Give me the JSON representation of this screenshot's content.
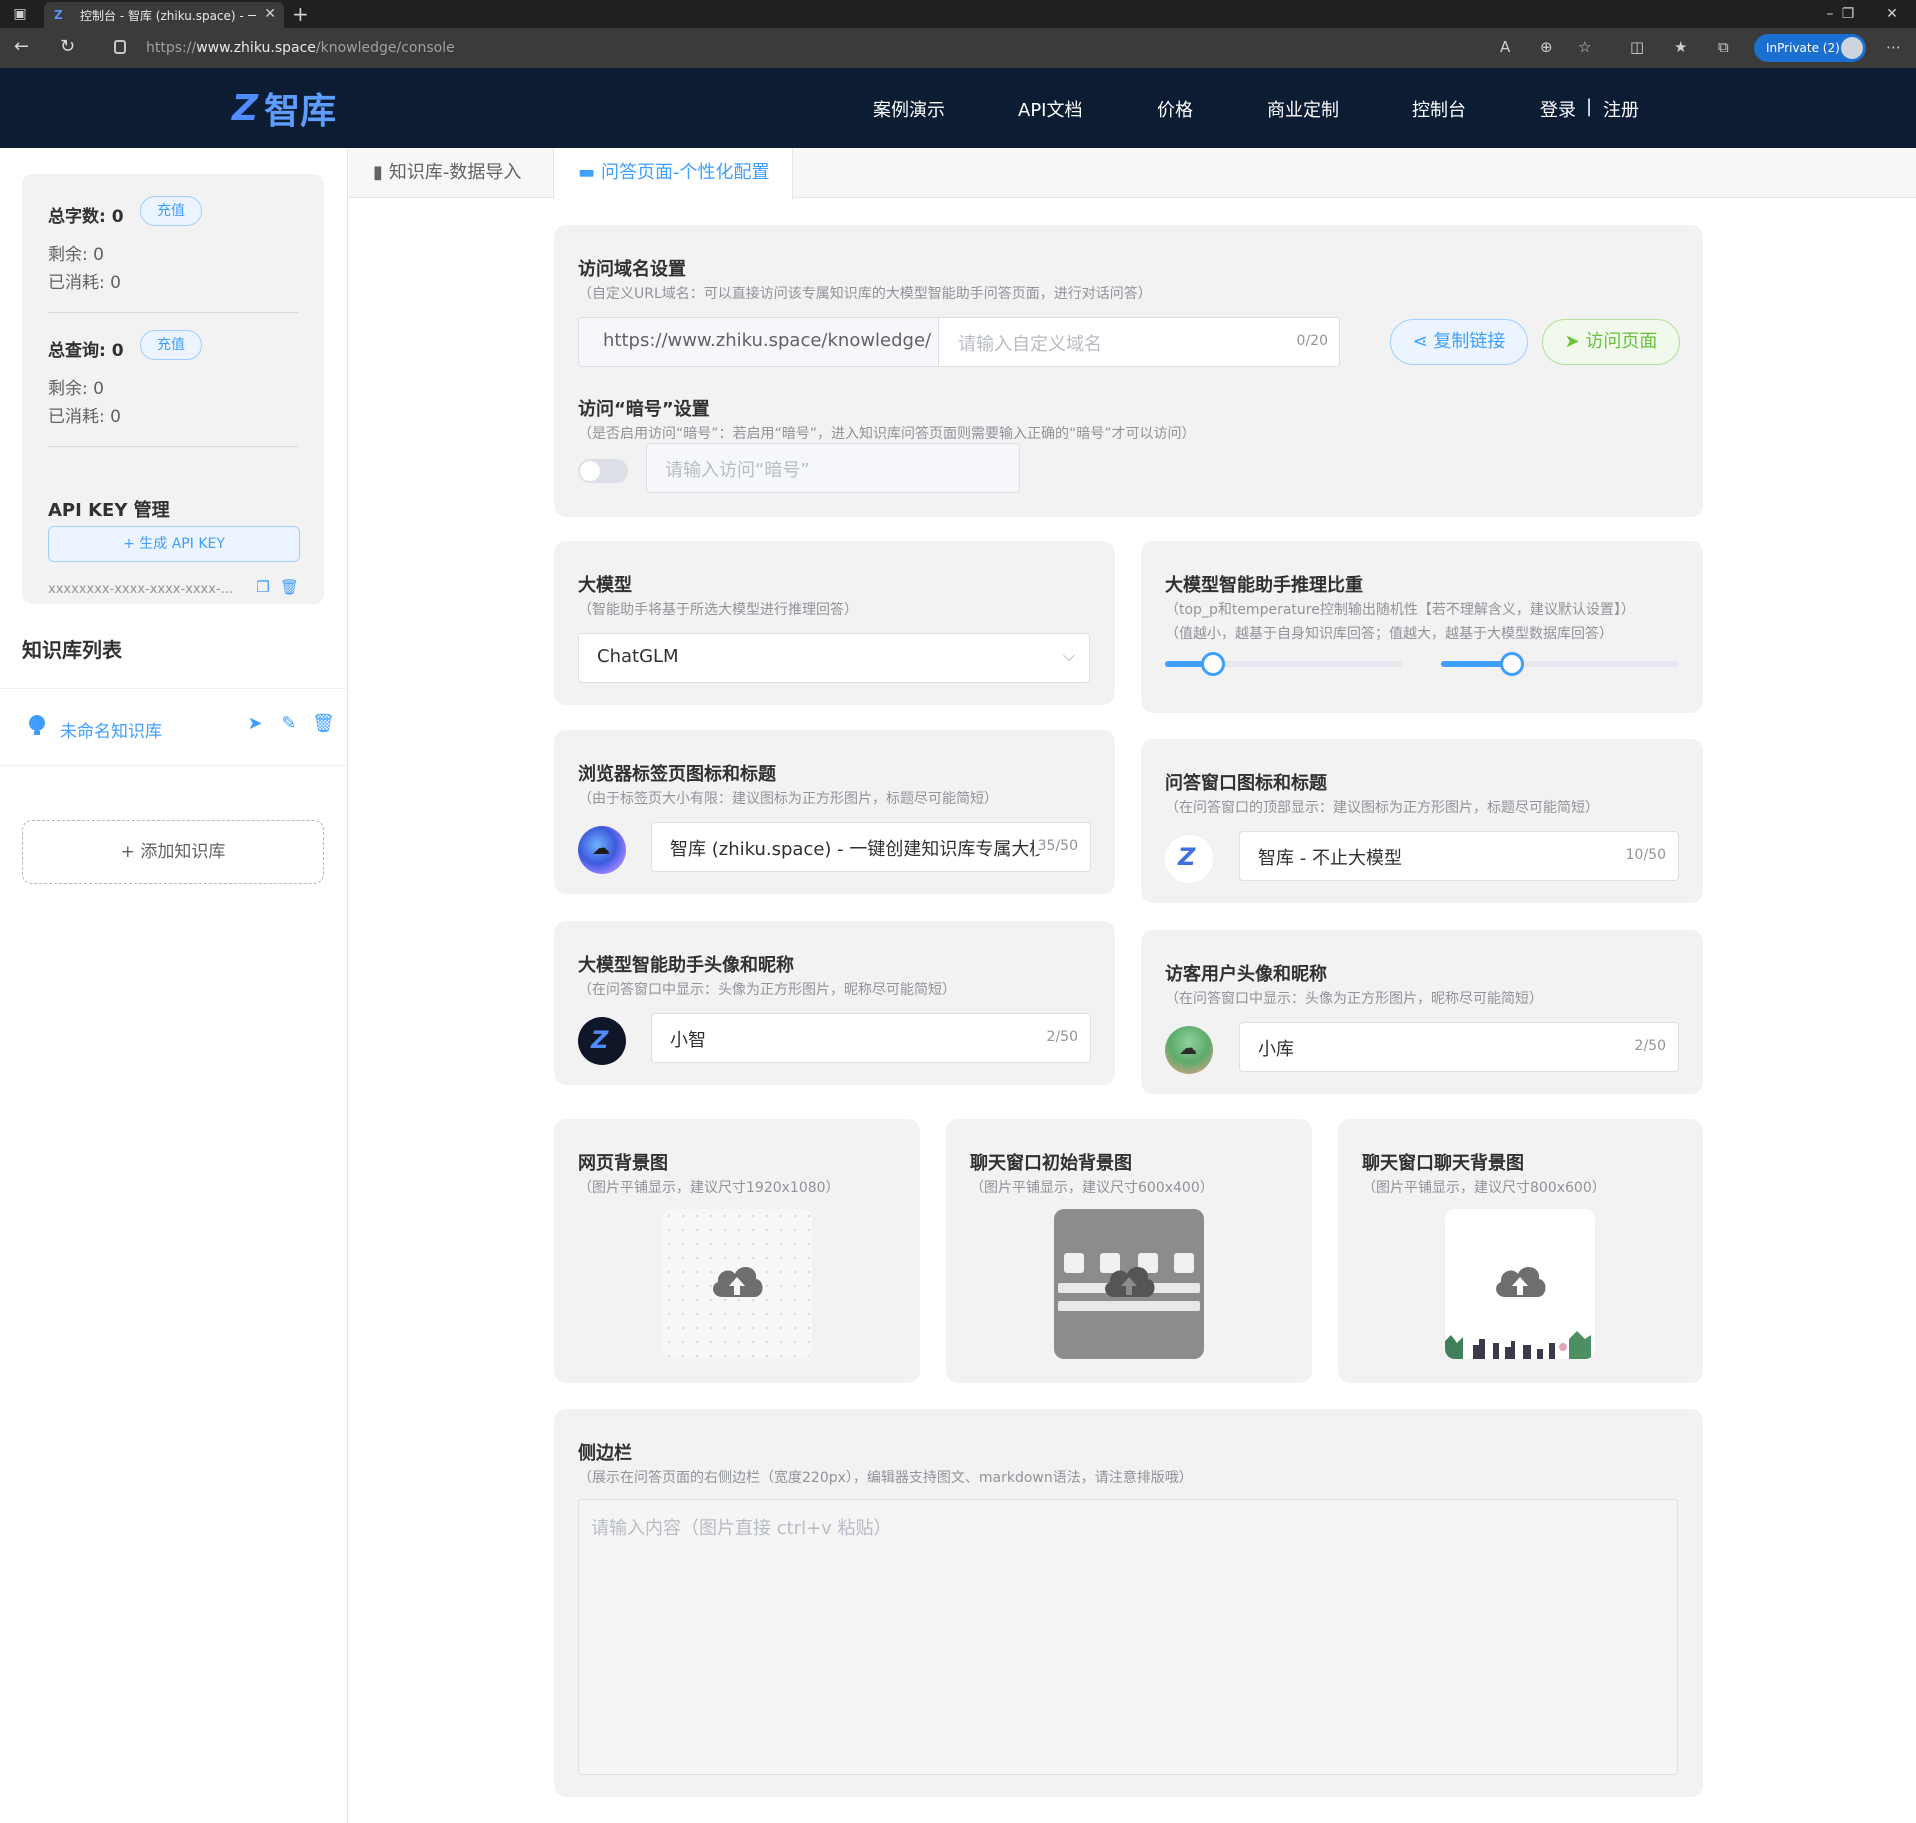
{
  "browser": {
    "tab_title": "控制台 - 智库 (zhiku.space) - 一键",
    "url_prefix": "https://",
    "url_host": "www.zhiku.space",
    "url_path": "/knowledge/console",
    "inprivate_label": "InPrivate (2)"
  },
  "site": {
    "logo_text": "智库",
    "nav": [
      "案例演示",
      "API文档",
      "价格",
      "商业定制",
      "控制台",
      "登录",
      "|",
      "注册"
    ]
  },
  "sidebar": {
    "total_chars_label": "总字数:",
    "total_chars_value": "0",
    "recharge_label": "充值",
    "remaining_label": "剩余: 0",
    "consumed_label": "已消耗: 0",
    "total_queries_label": "总查询:",
    "total_queries_value": "0",
    "remaining2_label": "剩余: 0",
    "consumed2_label": "已消耗: 0",
    "apikey_title": "API KEY 管理",
    "apikey_button": "+ 生成 API KEY",
    "apikey_value": "xxxxxxxx-xxxx-xxxx-xxxx-...",
    "kb_list_title": "知识库列表",
    "kb_item_name": "未命名知识库",
    "add_kb_label": "+ 添加知识库"
  },
  "tabs": {
    "import": "知识库-数据导入",
    "config": "问答页面-个性化配置"
  },
  "domain": {
    "title": "访问域名设置",
    "desc": "（自定义URL域名：可以直接访问该专属知识库的大模型智能助手问答页面，进行对话问答）",
    "prefix": "https://www.zhiku.space/knowledge/",
    "placeholder": "请输入自定义域名",
    "count": "0/20",
    "copy_button": "复制链接",
    "visit_button": "访问页面"
  },
  "password": {
    "title": "访问“暗号”设置",
    "desc": "（是否启用访问“暗号”：若启用“暗号”，进入知识库问答页面则需要输入正确的“暗号”才可以访问）",
    "placeholder": "请输入访问“暗号”",
    "enabled": false
  },
  "model": {
    "title": "大模型",
    "desc": "（智能助手将基于所选大模型进行推理回答）",
    "selected": "ChatGLM"
  },
  "ratio": {
    "title": "大模型智能助手推理比重",
    "desc1": "（top_p和temperature控制输出随机性【若不理解含义，建议默认设置】）",
    "desc2": "（值越小，越基于自身知识库回答；值越大，越基于大模型数据库回答）",
    "top_p": 0.2,
    "temperature": 0.3
  },
  "browser_tab": {
    "title": "浏览器标签页图标和标题",
    "desc": "（由于标签页大小有限：建议图标为正方形图片，标题尽可能简短）",
    "value": "智库 (zhiku.space) - 一键创建知识库专属大模型",
    "count": "35/50"
  },
  "chat_window": {
    "title": "问答窗口图标和标题",
    "desc": "（在问答窗口的顶部显示：建议图标为正方形图片，标题尽可能简短）",
    "value": "智库 - 不止大模型",
    "count": "10/50"
  },
  "assistant": {
    "title": "大模型智能助手头像和昵称",
    "desc": "（在问答窗口中显示：头像为正方形图片，昵称尽可能简短）",
    "value": "小智",
    "count": "2/50"
  },
  "visitor": {
    "title": "访客用户头像和昵称",
    "desc": "（在问答窗口中显示：头像为正方形图片，昵称尽可能简短）",
    "value": "小库",
    "count": "2/50"
  },
  "bg_page": {
    "title": "网页背景图",
    "desc": "（图片平铺显示，建议尺寸1920x1080）"
  },
  "bg_chat_init": {
    "title": "聊天窗口初始背景图",
    "desc": "（图片平铺显示，建议尺寸600x400）"
  },
  "bg_chat": {
    "title": "聊天窗口聊天背景图",
    "desc": "（图片平铺显示，建议尺寸800x600）"
  },
  "side_panel": {
    "title": "侧边栏",
    "desc": "（展示在问答页面的右侧边栏（宽度220px），编辑器支持图文、markdown语法，请注意排版哦）",
    "placeholder": "请输入内容（图片直接 ctrl+v 粘贴）"
  },
  "colors": {
    "primary": "#409eff",
    "success": "#67c23a",
    "header_bg": "#0b1c33",
    "card_bg": "#f2f2f2"
  }
}
